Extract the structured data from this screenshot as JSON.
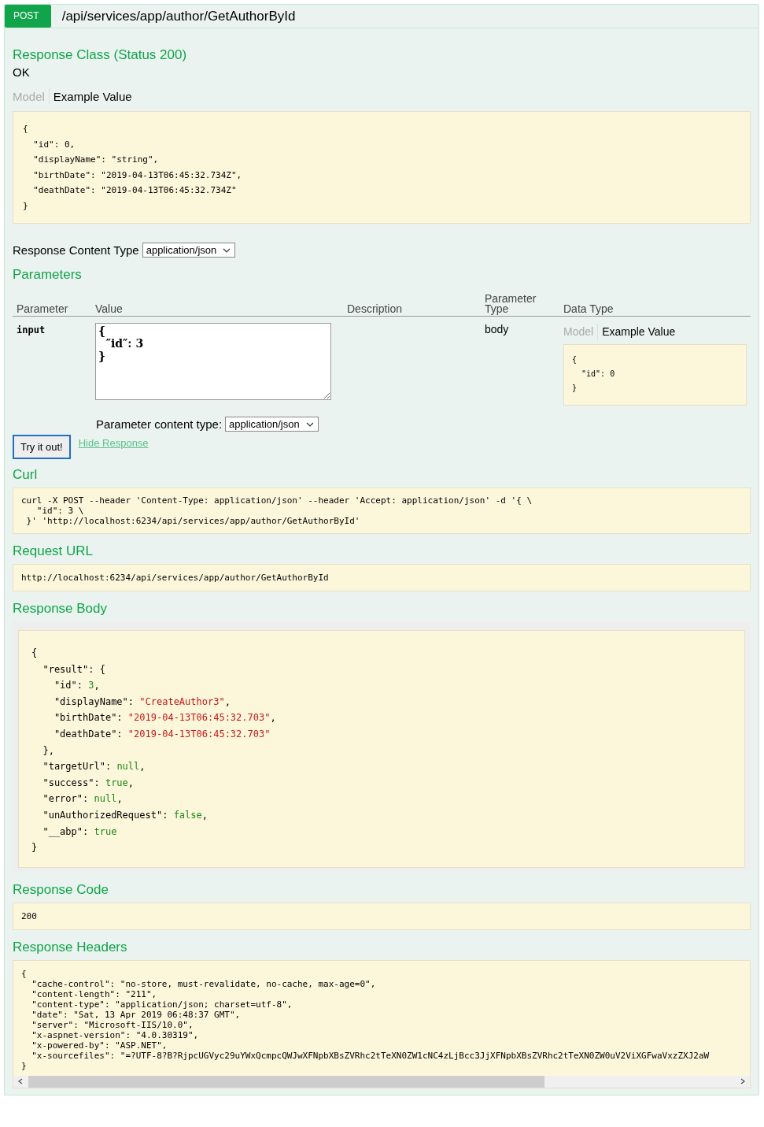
{
  "operation": {
    "method": "POST",
    "path": "/api/services/app/author/GetAuthorById"
  },
  "response_class": {
    "title": "Response Class (Status 200)",
    "status_text": "OK",
    "tabs": [
      {
        "label": "Model",
        "selected": false
      },
      {
        "label": "Example Value",
        "selected": true
      }
    ],
    "example_lines": [
      "{",
      "  \"id\": 0,",
      "  \"displayName\": \"string\",",
      "  \"birthDate\": \"2019-04-13T06:45:32.734Z\",",
      "  \"deathDate\": \"2019-04-13T06:45:32.734Z\"",
      "}"
    ]
  },
  "response_content_type": {
    "label": "Response Content Type",
    "value": "application/json"
  },
  "parameters": {
    "title": "Parameters",
    "columns": [
      "Parameter",
      "Value",
      "Description",
      "Parameter Type",
      "Data Type"
    ],
    "rows": [
      {
        "name": "input",
        "value": "{\n  ″id″: 3\n}",
        "parameter_type": "body",
        "tabs": [
          {
            "label": "Model",
            "selected": false
          },
          {
            "label": "Example Value",
            "selected": true
          }
        ],
        "example_lines": [
          "{",
          "  \"id\": 0",
          "}"
        ]
      }
    ],
    "content_type": {
      "label": "Parameter content type:",
      "value": "application/json"
    }
  },
  "try_button": "Try it out!",
  "hide_link": "Hide Response",
  "curl": {
    "title": "Curl",
    "lines": [
      "curl -X POST --header 'Content-Type: application/json' --header 'Accept: application/json' -d '{ \\",
      "   \"id\": 3 \\",
      " }' 'http://localhost:6234/api/services/app/author/GetAuthorById'"
    ]
  },
  "request_url": {
    "title": "Request URL",
    "value": "http://localhost:6234/api/services/app/author/GetAuthorById"
  },
  "response_body": {
    "title": "Response Body",
    "lines": [
      [
        {
          "text": "{",
          "kind": "punct"
        }
      ],
      [
        {
          "text": "  \"result\": {",
          "kind": "punct"
        }
      ],
      [
        {
          "text": "    \"id\": ",
          "kind": "punct"
        },
        {
          "text": "3",
          "kind": "literal"
        },
        {
          "text": ",",
          "kind": "punct"
        }
      ],
      [
        {
          "text": "    \"displayName\": ",
          "kind": "punct"
        },
        {
          "text": "\"CreateAuthor3\"",
          "kind": "string"
        },
        {
          "text": ",",
          "kind": "punct"
        }
      ],
      [
        {
          "text": "    \"birthDate\": ",
          "kind": "punct"
        },
        {
          "text": "\"2019-04-13T06:45:32.703\"",
          "kind": "string"
        },
        {
          "text": ",",
          "kind": "punct"
        }
      ],
      [
        {
          "text": "    \"deathDate\": ",
          "kind": "punct"
        },
        {
          "text": "\"2019-04-13T06:45:32.703\"",
          "kind": "string"
        }
      ],
      [
        {
          "text": "  },",
          "kind": "punct"
        }
      ],
      [
        {
          "text": "  \"targetUrl\": ",
          "kind": "punct"
        },
        {
          "text": "null",
          "kind": "literal"
        },
        {
          "text": ",",
          "kind": "punct"
        }
      ],
      [
        {
          "text": "  \"success\": ",
          "kind": "punct"
        },
        {
          "text": "true",
          "kind": "literal"
        },
        {
          "text": ",",
          "kind": "punct"
        }
      ],
      [
        {
          "text": "  \"error\": ",
          "kind": "punct"
        },
        {
          "text": "null",
          "kind": "literal"
        },
        {
          "text": ",",
          "kind": "punct"
        }
      ],
      [
        {
          "text": "  \"unAuthorizedRequest\": ",
          "kind": "punct"
        },
        {
          "text": "false",
          "kind": "literal"
        },
        {
          "text": ",",
          "kind": "punct"
        }
      ],
      [
        {
          "text": "  \"__abp\": ",
          "kind": "punct"
        },
        {
          "text": "true",
          "kind": "literal"
        }
      ],
      [
        {
          "text": "}",
          "kind": "punct"
        }
      ]
    ]
  },
  "response_code": {
    "title": "Response Code",
    "value": "200"
  },
  "response_headers": {
    "title": "Response Headers",
    "lines": [
      "{",
      "  \"cache-control\": \"no-store, must-revalidate, no-cache, max-age=0\",",
      "  \"content-length\": \"211\",",
      "  \"content-type\": \"application/json; charset=utf-8\",",
      "  \"date\": \"Sat, 13 Apr 2019 06:48:37 GMT\",",
      "  \"server\": \"Microsoft-IIS/10.0\",",
      "  \"x-aspnet-version\": \"4.0.30319\",",
      "  \"x-powered-by\": \"ASP.NET\",",
      "  \"x-sourcefiles\": \"=?UTF-8?B?RjpcUGVyc29uYWxQcmpcQWJwXFNpbXBsZVRhc2tTeXN0ZW1cNC4zLjBcc3JjXFNpbXBsZVRhc2tTeXN0ZW0uV2ViXGFwaVxzZXJ2aW",
      "}"
    ]
  }
}
